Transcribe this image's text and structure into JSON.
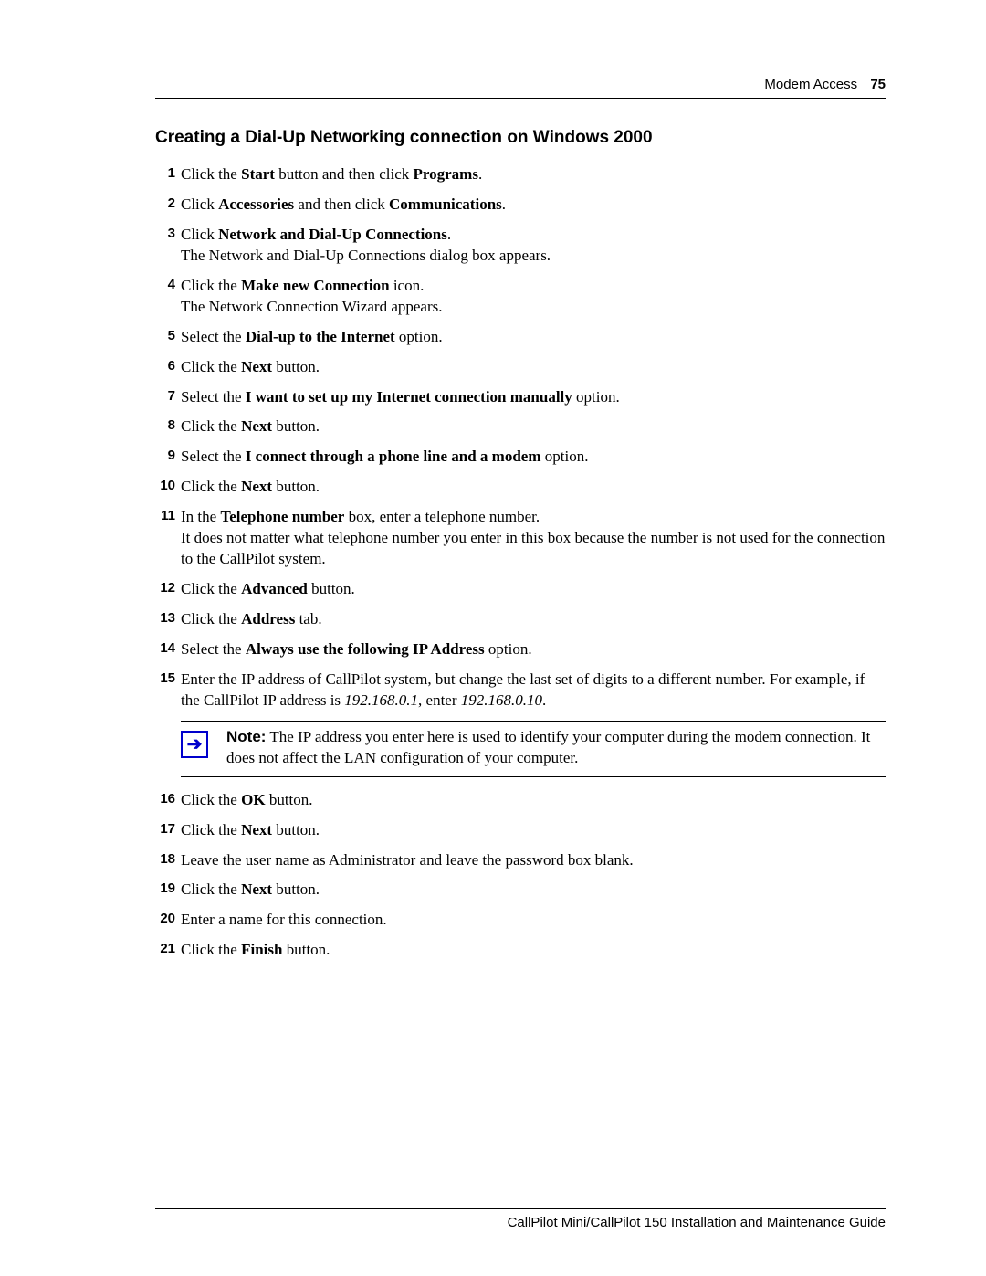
{
  "header": {
    "section": "Modem Access",
    "page": "75"
  },
  "title": "Creating a Dial-Up Networking connection on Windows 2000",
  "steps": [
    {
      "n": "1",
      "html": "Click the <b>Start</b> button and then click <b>Programs</b>."
    },
    {
      "n": "2",
      "html": "Click <b>Accessories</b> and then click <b>Communications</b>."
    },
    {
      "n": "3",
      "html": "Click <b>Network and Dial-Up Connections</b>.<br>The Network and Dial-Up Connections dialog box appears."
    },
    {
      "n": "4",
      "html": "Click the <b>Make new Connection</b> icon.<br>The Network Connection Wizard appears."
    },
    {
      "n": "5",
      "html": "Select the <b>Dial-up to the Internet</b> option."
    },
    {
      "n": "6",
      "html": "Click the <b>Next</b> button."
    },
    {
      "n": "7",
      "html": "Select the <b>I want to set up my Internet connection manually</b> option."
    },
    {
      "n": "8",
      "html": "Click the <b>Next</b> button."
    },
    {
      "n": "9",
      "html": "Select the <b>I connect through a phone line and a modem</b> option."
    },
    {
      "n": "10",
      "html": "Click the <b>Next</b> button."
    },
    {
      "n": "11",
      "html": "In the <b>Telephone number</b> box, enter a telephone number.<br>It does not matter what telephone number you enter in this box because the number is not used for the connection to the CallPilot system."
    },
    {
      "n": "12",
      "html": "Click the <b>Advanced</b> button."
    },
    {
      "n": "13",
      "html": "Click the <b>Address</b> tab."
    },
    {
      "n": "14",
      "html": "Select the <b>Always use the following IP Address</b> option."
    },
    {
      "n": "15",
      "html": "Enter the IP address of CallPilot system, but change the last set of digits to a different number. For example, if the CallPilot IP address is <i>192.168.0.1</i>, enter <i>192.168.0.10</i>."
    }
  ],
  "note": {
    "label": "Note:",
    "text": "The IP address you enter here is used to identify your computer during the modem connection. It does not affect the LAN configuration of your computer."
  },
  "steps2": [
    {
      "n": "16",
      "html": "Click the <b>OK</b> button."
    },
    {
      "n": "17",
      "html": "Click the <b>Next</b> button."
    },
    {
      "n": "18",
      "html": "Leave the user name as Administrator and leave the password box blank."
    },
    {
      "n": "19",
      "html": "Click the <b>Next</b> button."
    },
    {
      "n": "20",
      "html": "Enter a name for this connection."
    },
    {
      "n": "21",
      "html": "Click the <b>Finish</b> button."
    }
  ],
  "footer": "CallPilot Mini/CallPilot 150 Installation and Maintenance Guide"
}
